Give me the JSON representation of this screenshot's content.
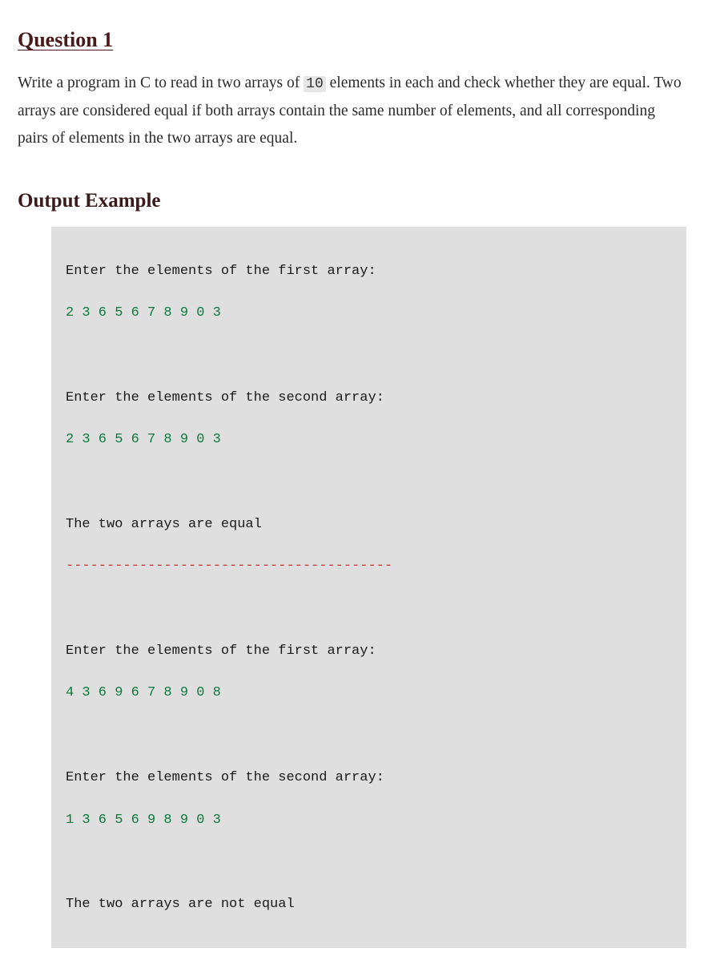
{
  "heading": "Question 1",
  "prompt": {
    "before_code": "Write a program in C to read in two arrays of ",
    "code": "10",
    "after_code": " elements in each and check whether they are equal. Two arrays are considered equal if both arrays contain the same number of elements, and all corresponding pairs of elements in the two arrays are equal."
  },
  "subheading": "Output Example",
  "output": {
    "run1": {
      "prompt1": "Enter the elements of the first array:",
      "input1": "2 3 6 5 6 7 8 9 0 3",
      "prompt2": "Enter the elements of the second array:",
      "input2": "2 3 6 5 6 7 8 9 0 3",
      "result": "The two arrays are equal"
    },
    "separator": "----------------------------------------",
    "run2": {
      "prompt1": "Enter the elements of the first array:",
      "input1": "4 3 6 9 6 7 8 9 0 8",
      "prompt2": "Enter the elements of the second array:",
      "input2": "1 3 6 5 6 9 8 9 0 3",
      "result": "The two arrays are not equal"
    }
  }
}
